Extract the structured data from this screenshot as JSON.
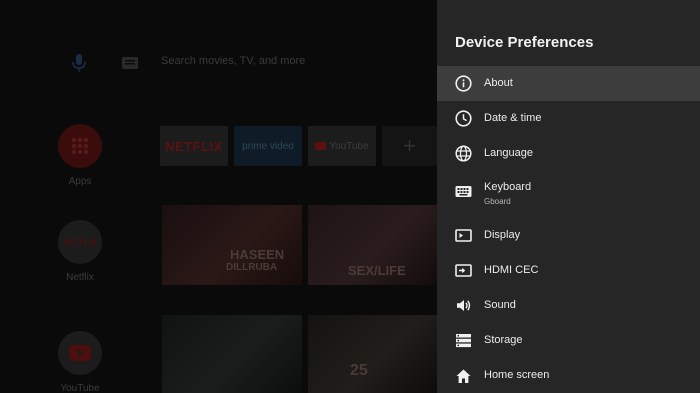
{
  "home": {
    "search_placeholder": "Search movies, TV, and more",
    "left_apps": [
      {
        "label": "Apps"
      },
      {
        "label": "Netflix"
      },
      {
        "label": "YouTube"
      }
    ],
    "tiles": {
      "netflix": "NETFLIX",
      "prime": "prime video",
      "youtube": "YouTube",
      "add": "+"
    },
    "posters": {
      "p1_title_line1": "HASEEN",
      "p1_title_line2": "DILLRUBA",
      "p2_title": "SEX/LIFE",
      "p4_title": "25"
    }
  },
  "panel": {
    "title": "Device Preferences",
    "items": [
      {
        "label": "About",
        "icon": "info-icon",
        "selected": true
      },
      {
        "label": "Date & time",
        "icon": "clock-icon"
      },
      {
        "label": "Language",
        "icon": "globe-icon"
      },
      {
        "label": "Keyboard",
        "sub": "Gboard",
        "icon": "keyboard-icon"
      },
      {
        "label": "Display",
        "icon": "display-icon"
      },
      {
        "label": "HDMI CEC",
        "icon": "hdmi-cec-icon"
      },
      {
        "label": "Sound",
        "icon": "speaker-icon"
      },
      {
        "label": "Storage",
        "icon": "storage-icon"
      },
      {
        "label": "Home screen",
        "icon": "home-icon"
      }
    ]
  },
  "colors": {
    "panel_bg": "#262626",
    "selected_row": "#3d3d3d",
    "text": "#ececec"
  }
}
